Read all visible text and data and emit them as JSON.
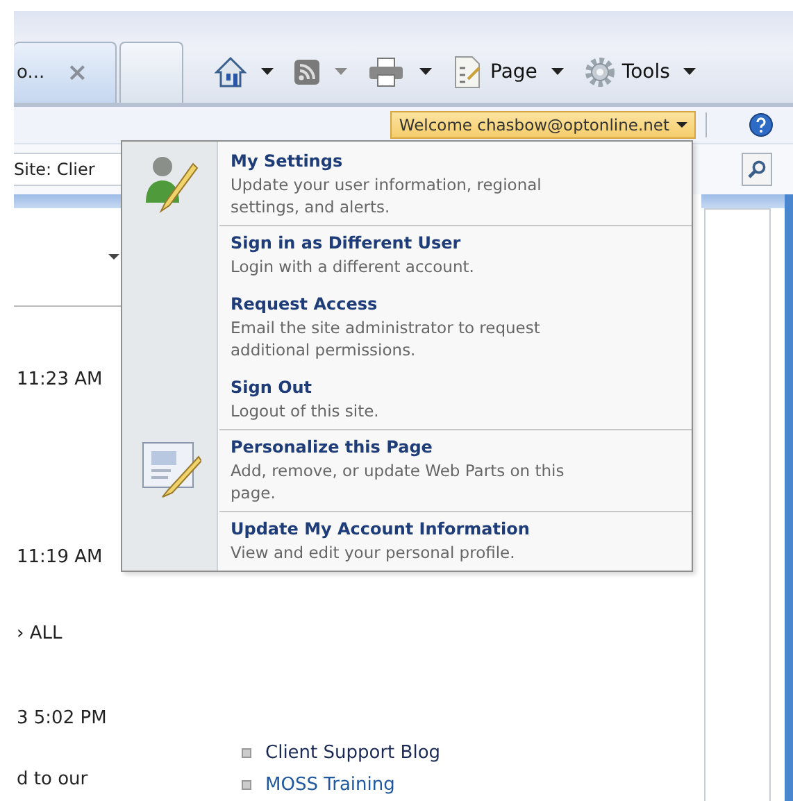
{
  "browser": {
    "tabs": [
      {
        "label": "o...",
        "close": "×",
        "selected": true
      },
      {
        "selected": false
      }
    ],
    "toolbar": [
      {
        "kind": "home"
      },
      {
        "kind": "feed"
      },
      {
        "kind": "print"
      },
      {
        "kind": "page",
        "label": "Page"
      },
      {
        "kind": "tools",
        "label": "Tools"
      }
    ]
  },
  "welcome": {
    "label": "Welcome chasbow@optonline.net"
  },
  "search": {
    "scope": "Site: Clier"
  },
  "list": {
    "times": [
      "11:23 AM",
      "11:19 AM",
      "› ALL",
      "3 5:02 PM",
      "d to our"
    ]
  },
  "links": [
    "Client Support Blog",
    "MOSS Training"
  ],
  "menu": [
    {
      "kind": "user",
      "title": "My Settings",
      "description": "Update your user information, regional settings, and alerts."
    },
    {
      "kind": "plain",
      "title": "Sign in as Different User",
      "description": "Login with a different account."
    },
    {
      "kind": "plain",
      "title": "Request Access",
      "description": "Email the site administrator to request additional permissions."
    },
    {
      "kind": "plain",
      "title": "Sign Out",
      "description": "Logout of this site."
    },
    {
      "kind": "page",
      "title": "Personalize this Page",
      "description": "Add, remove, or update Web Parts on this page."
    },
    {
      "kind": "plain",
      "title": "Update My Account Information",
      "description": "View and edit your personal profile."
    }
  ]
}
